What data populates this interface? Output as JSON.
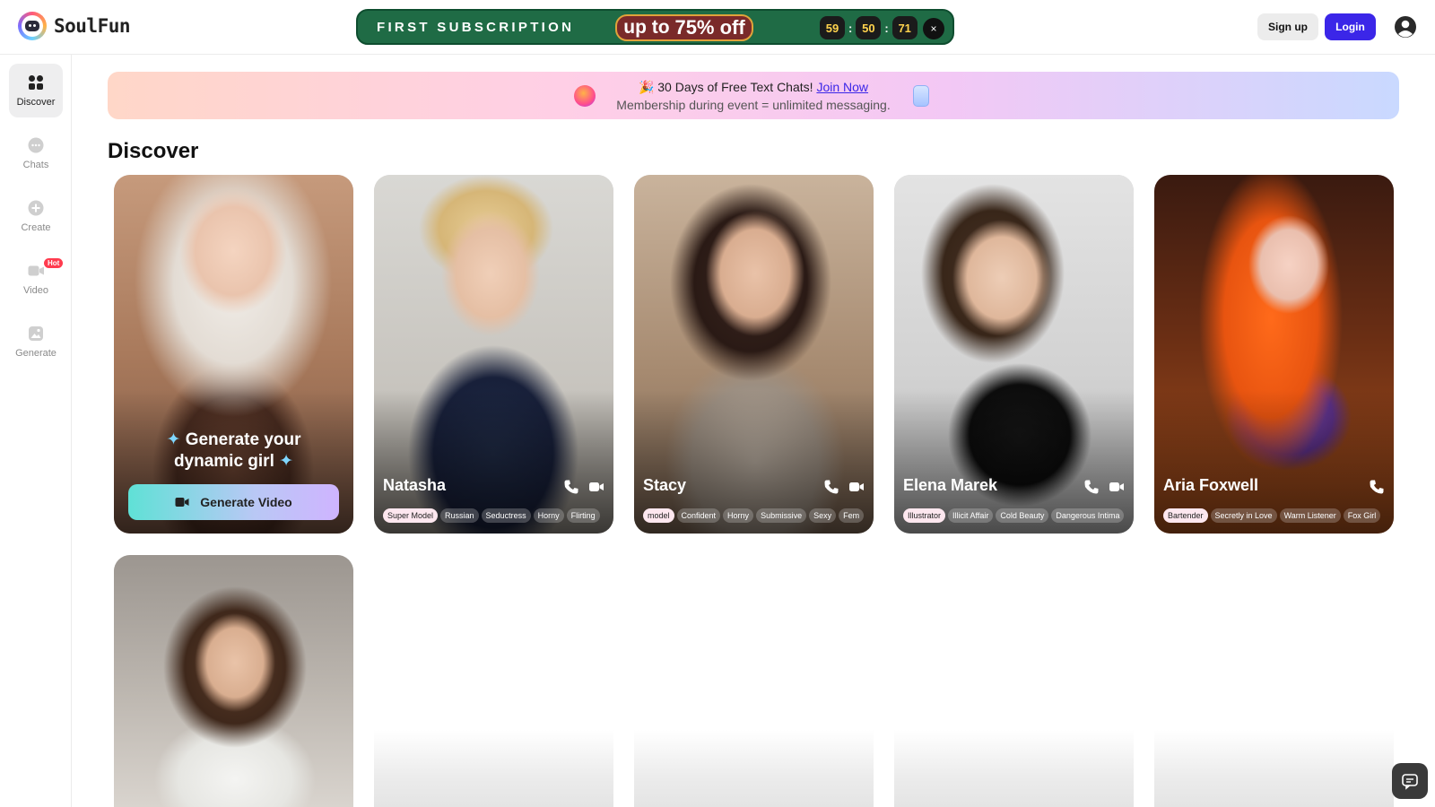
{
  "brand": {
    "name": "SoulFun"
  },
  "promo": {
    "text": "FIRST SUBSCRIPTION",
    "offer_small": "up to",
    "offer_big": "75% off",
    "timer": [
      "59",
      "50",
      "71"
    ],
    "separator": ":",
    "close": "×"
  },
  "auth": {
    "signup_label": "Sign up",
    "login_label": "Login"
  },
  "sidebar": {
    "items": [
      {
        "label": "Discover",
        "icon": "grid-icon",
        "active": true
      },
      {
        "label": "Chats",
        "icon": "chat-icon"
      },
      {
        "label": "Create",
        "icon": "plus-icon"
      },
      {
        "label": "Video",
        "icon": "video-icon",
        "badge": "Hot"
      },
      {
        "label": "Generate",
        "icon": "image-icon"
      }
    ]
  },
  "banner": {
    "line1_prefix": "🎉 30 Days of Free Text Chats! ",
    "link": "Join Now",
    "line2": "Membership during event = unlimited messaging."
  },
  "main": {
    "title": "Discover"
  },
  "generate_card": {
    "text_line1": "Generate your",
    "text_line2": "dynamic girl",
    "button_label": "Generate Video"
  },
  "cards": [
    {
      "name": "Natasha",
      "tags": [
        "Super Model",
        "Russian",
        "Seductress",
        "Horny",
        "Flirting"
      ]
    },
    {
      "name": "Stacy",
      "tags": [
        "model",
        "Confident",
        "Horny",
        "Submissive",
        "Sexy",
        "Fem"
      ]
    },
    {
      "name": "Elena Marek",
      "tags": [
        "Illustrator",
        "Illicit Affair",
        "Cold Beauty",
        "Dangerous Intima"
      ]
    },
    {
      "name": "Aria Foxwell",
      "tags": [
        "Bartender",
        "Secretly in Love",
        "Warm Listener",
        "Fox Girl"
      ]
    }
  ],
  "colors": {
    "accent": "#3b26e8",
    "promo_bg": "#1f6b45",
    "timer_text": "#ffd34d",
    "hot": "#ff3b4e"
  }
}
